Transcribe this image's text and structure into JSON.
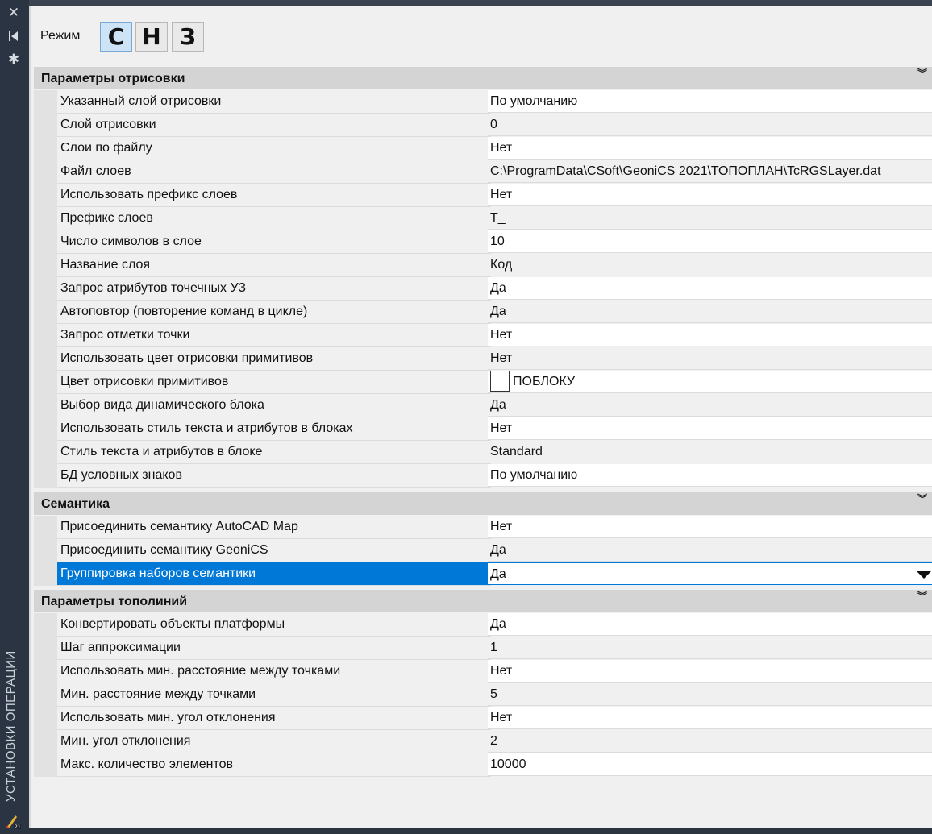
{
  "sidebar": {
    "title": "УСТАНОВКИ ОПЕРАЦИИ",
    "icons": [
      "close-icon",
      "collapse-icon",
      "settings-icon"
    ]
  },
  "mode": {
    "label": "Режим",
    "buttons": [
      {
        "label": "С",
        "active": true
      },
      {
        "label": "Н",
        "active": false
      },
      {
        "label": "З",
        "active": false
      }
    ]
  },
  "sections": [
    {
      "title": "Параметры отрисовки",
      "toggle": "»",
      "rows": [
        {
          "name": "Указанный слой отрисовки",
          "value": "По умолчанию"
        },
        {
          "name": "Слой отрисовки",
          "value": "0"
        },
        {
          "name": "Слои по файлу",
          "value": "Нет"
        },
        {
          "name": "Файл слоев",
          "value": "C:\\ProgramData\\CSoft\\GeoniCS 2021\\ТОПОПЛАН\\TcRGSLayer.dat"
        },
        {
          "name": "Использовать префикс слоев",
          "value": "Нет"
        },
        {
          "name": "Префикс слоев",
          "value": "T_"
        },
        {
          "name": "Число символов в слое",
          "value": "10"
        },
        {
          "name": "Название слоя",
          "value": "Код"
        },
        {
          "name": "Запрос атрибутов точечных УЗ",
          "value": "Да"
        },
        {
          "name": "Автоповтор (повторение команд в цикле)",
          "value": "Да"
        },
        {
          "name": "Запрос отметки точки",
          "value": "Нет"
        },
        {
          "name": "Использовать цвет отрисовки примитивов",
          "value": "Нет"
        },
        {
          "name": "Цвет отрисовки примитивов",
          "value": "ПОБЛОКУ",
          "swatch": "#ffffff"
        },
        {
          "name": "Выбор вида динамического блока",
          "value": "Да"
        },
        {
          "name": "Использовать стиль текста и атрибутов в блоках",
          "value": "Нет"
        },
        {
          "name": "Стиль текста и атрибутов в блоке",
          "value": "Standard"
        },
        {
          "name": "БД условных знаков",
          "value": "По умолчанию"
        }
      ]
    },
    {
      "title": "Семантика",
      "toggle": "»",
      "rows": [
        {
          "name": "Присоединить семантику AutoCAD Map",
          "value": "Нет"
        },
        {
          "name": "Присоединить семантику GeoniCS",
          "value": "Да"
        },
        {
          "name": "Группировка наборов семантики",
          "value": "Да",
          "selected": true
        }
      ]
    },
    {
      "title": "Параметры тополиний",
      "toggle": "»",
      "rows": [
        {
          "name": "Конвертировать объекты платформы",
          "value": "Да"
        },
        {
          "name": "Шаг аппроксимации",
          "value": "1"
        },
        {
          "name": "Использовать мин. расстояние между точками",
          "value": "Нет"
        },
        {
          "name": "Мин. расстояние между точками",
          "value": "5"
        },
        {
          "name": "Использовать мин. угол отклонения",
          "value": "Нет"
        },
        {
          "name": "Мин. угол отклонения",
          "value": "2"
        },
        {
          "name": "Макс. количество элементов",
          "value": "10000"
        }
      ]
    }
  ]
}
